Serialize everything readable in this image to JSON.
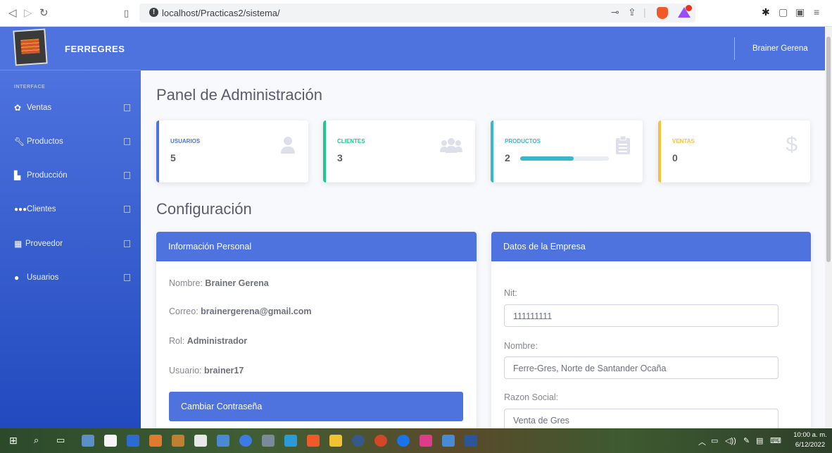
{
  "browser": {
    "url": "localhost/Practicas2/sistema/"
  },
  "brand": {
    "name": "FERREGRES"
  },
  "sidebar": {
    "heading": "INTERFACE",
    "items": [
      {
        "label": "Ventas",
        "icon": "gear-icon"
      },
      {
        "label": "Productos",
        "icon": "wrench-icon"
      },
      {
        "label": "Producción",
        "icon": "industry-icon"
      },
      {
        "label": "Clientes",
        "icon": "users-icon"
      },
      {
        "label": "Proveedor",
        "icon": "building-icon"
      },
      {
        "label": "Usuarios",
        "icon": "user-icon"
      }
    ]
  },
  "topbar": {
    "user_name": "Brainer Gerena"
  },
  "main": {
    "title": "Panel de Administración",
    "cards": [
      {
        "label": "USUARIOS",
        "value": "5",
        "color": "#4e73df",
        "icon": "user-icon"
      },
      {
        "label": "CLIENTES",
        "value": "3",
        "color": "#1cc88a",
        "icon": "users-icon"
      },
      {
        "label": "PRODUCTOS",
        "value": "2",
        "color": "#36b9cc",
        "icon": "clipboard-icon",
        "progress_fraction": 0.6
      },
      {
        "label": "VENTAS",
        "value": "0",
        "color": "#f6c23e",
        "icon": "dollar-icon"
      }
    ],
    "config_title": "Configuración",
    "personal": {
      "header": "Información Personal",
      "name_label": "Nombre:",
      "name_value": "Brainer Gerena",
      "email_label": "Correo:",
      "email_value": "brainergerena@gmail.com",
      "role_label": "Rol:",
      "role_value": "Administrador",
      "user_label": "Usuario:",
      "user_value": "brainer17",
      "change_password_button": "Cambiar Contraseña"
    },
    "company": {
      "header": "Datos de la Empresa",
      "nit_label": "Nit:",
      "nit_value": "111111111",
      "nombre_label": "Nombre:",
      "nombre_value": "Ferre-Gres, Norte de Santander Ocaña",
      "razon_label": "Razon Social:",
      "razon_value": "Venta de Gres"
    }
  },
  "taskbar": {
    "time": "10:00 a. m.",
    "date": "6/12/2022"
  }
}
